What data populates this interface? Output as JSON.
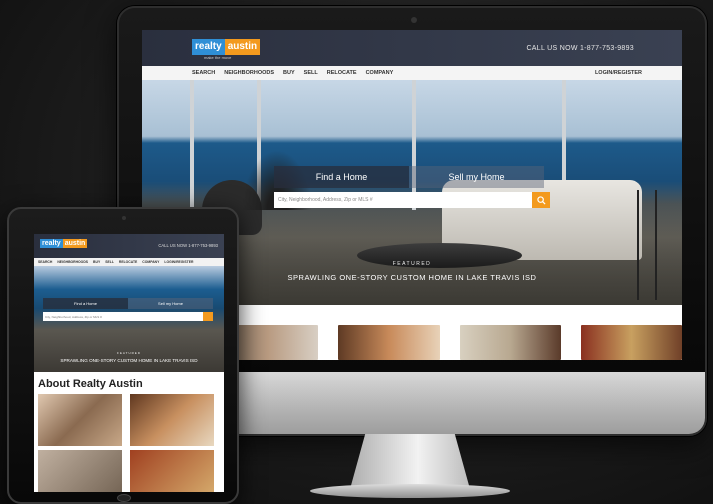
{
  "desktop": {
    "logo": {
      "part1": "realty",
      "part2": "austin",
      "tagline": "make the move"
    },
    "phone": "CALL US NOW  1-877-753-9893",
    "nav": [
      "SEARCH",
      "NEIGHBORHOODS",
      "BUY",
      "SELL",
      "RELOCATE",
      "COMPANY"
    ],
    "login": "LOGIN/REGISTER",
    "tabs": {
      "find": "Find a Home",
      "sell": "Sell my Home"
    },
    "search": {
      "placeholder": "City, Neighborhood, Address, Zip or MLS #"
    },
    "featured": {
      "label": "FEATURED",
      "title": "SPRAWLING ONE-STORY CUSTOM HOME IN LAKE TRAVIS ISD"
    },
    "icons": {
      "search": "search-icon"
    }
  },
  "tablet": {
    "logo": {
      "part1": "realty",
      "part2": "austin"
    },
    "phone": "CALL US NOW  1-877-753-9893",
    "nav": [
      "SEARCH",
      "NEIGHBORHOODS",
      "BUY",
      "SELL",
      "RELOCATE",
      "COMPANY",
      "LOGIN/REGISTER"
    ],
    "tabs": {
      "find": "Find a Home",
      "sell": "Sell my Home"
    },
    "search": {
      "placeholder": "City, Neighborhood, Address, Zip or MLS #"
    },
    "featured": {
      "label": "FEATURED",
      "title": "SPRAWLING ONE-STORY CUSTOM HOME IN LAKE TRAVIS ISD"
    },
    "about_heading": "About Realty Austin"
  },
  "colors": {
    "brand_blue": "#2f8fd6",
    "brand_orange": "#f39a1e",
    "header_dark": "#2a2f3e"
  }
}
